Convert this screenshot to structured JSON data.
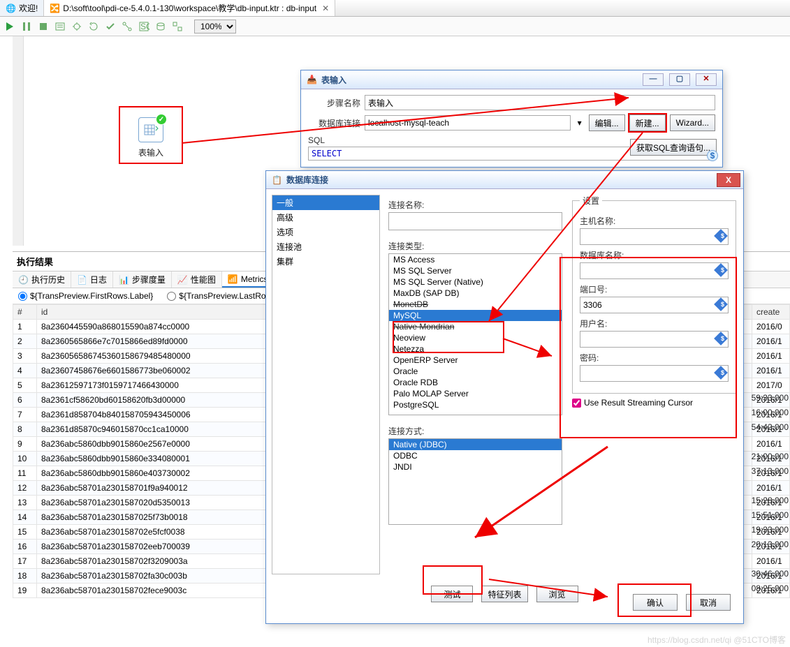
{
  "tabs": {
    "welcome": "欢迎!",
    "file": "D:\\soft\\tool\\pdi-ce-5.4.0.1-130\\workspace\\教学\\db-input.ktr : db-input"
  },
  "toolbar": {
    "zoom": "100%"
  },
  "node": {
    "label": "表输入"
  },
  "results": {
    "title": "执行结果",
    "tabs": [
      "执行历史",
      "日志",
      "步骤度量",
      "性能图",
      "Metrics"
    ],
    "radio1": "${TransPreview.FirstRows.Label}",
    "radio2": "${TransPreview.LastRo",
    "cols": [
      "#",
      "id",
      "create"
    ]
  },
  "rows": [
    {
      "n": "1",
      "id": "8a2360445590a868015590a874cc0000",
      "c": "2016/0"
    },
    {
      "n": "2",
      "id": "8a2360565866e7c7015866ed89fd0000",
      "c": "2016/1"
    },
    {
      "n": "3",
      "id": "8a236056586745360158679485480000",
      "c": "2016/1"
    },
    {
      "n": "4",
      "id": "8a23607458676e6601586773be060002",
      "c": "2016/1"
    },
    {
      "n": "5",
      "id": "8a23612597173f0159717466430000",
      "c": "2017/0"
    },
    {
      "n": "6",
      "id": "8a2361cf58620bd60158620fb3d00000",
      "c": "2016/1"
    },
    {
      "n": "7",
      "id": "8a2361d858704b840158705943450006",
      "c": "2016/1"
    },
    {
      "n": "8",
      "id": "8a2361d85870c946015870cc1ca10000",
      "c": "2016/1"
    },
    {
      "n": "9",
      "id": "8a236abc5860dbb9015860e2567e0000",
      "c": "2016/1"
    },
    {
      "n": "10",
      "id": "8a236abc5860dbb9015860e334080001",
      "c": "2016/1"
    },
    {
      "n": "11",
      "id": "8a236abc5860dbb9015860e403730002",
      "c": "2016/1"
    },
    {
      "n": "12",
      "id": "8a236abc58701a230158701f9a940012",
      "c": "2016/1"
    },
    {
      "n": "13",
      "id": "8a236abc58701a2301587020d5350013",
      "c": "2016/1"
    },
    {
      "n": "14",
      "id": "8a236abc58701a2301587025f73b0018",
      "c": "2016/1"
    },
    {
      "n": "15",
      "id": "8a236abc58701a230158702e5fcf0038",
      "c": "2016/1"
    },
    {
      "n": "16",
      "id": "8a236abc58701a230158702eeb700039",
      "c": "2016/1"
    },
    {
      "n": "17",
      "id": "8a236abc58701a230158702f3209003a",
      "c": "2016/1"
    },
    {
      "n": "18",
      "id": "8a236abc58701a230158702fa30c003b",
      "c": "2016/1"
    },
    {
      "n": "19",
      "id": "8a236abc58701a230158702fece9003c",
      "c": "2016/1"
    }
  ],
  "right_times": [
    "59:33.000",
    "16:00.000",
    "54:42.000",
    "",
    "21:00.000",
    "37:13.000",
    "",
    "15:28.000",
    "15:51.000",
    "19:33.000",
    "20:13.000",
    "",
    "30:46.000",
    "08:25.000"
  ],
  "dlg1": {
    "title": "表输入",
    "step_label": "步骤名称",
    "step_value": "表输入",
    "conn_label": "数据库连接",
    "conn_value": "localhost-mysql-teach",
    "btn_edit": "编辑...",
    "btn_new": "新建...",
    "btn_wizard": "Wizard...",
    "sql_label": "SQL",
    "btn_fetch": "获取SQL查询语句...",
    "sql_text": "SELECT"
  },
  "dlg2": {
    "title": "数据库连接",
    "nav": [
      "一般",
      "高级",
      "选项",
      "连接池",
      "集群"
    ],
    "conn_name_label": "连接名称:",
    "conn_name": "",
    "type_label": "连接类型:",
    "types": [
      "MS Access",
      "MS SQL Server",
      "MS SQL Server (Native)",
      "MaxDB (SAP DB)",
      "MonetDB",
      "MySQL",
      "Native Mondrian",
      "Neoview",
      "Netezza",
      "OpenERP Server",
      "Oracle",
      "Oracle RDB",
      "Palo MOLAP Server",
      "PostgreSQL"
    ],
    "type_selected": "MySQL",
    "access_label": "连接方式:",
    "access": [
      "Native (JDBC)",
      "ODBC",
      "JNDI"
    ],
    "access_selected": "Native (JDBC)",
    "settings_label": "设置",
    "host_label": "主机名称:",
    "db_label": "数据库名称:",
    "port_label": "端口号:",
    "port_value": "3306",
    "user_label": "用户名:",
    "pass_label": "密码:",
    "chk_label": "Use Result Streaming Cursor",
    "btn_test": "测试",
    "btn_feat": "特征列表",
    "btn_browse": "浏览",
    "btn_ok": "确认",
    "btn_cancel": "取消"
  },
  "watermark": "https://blog.csdn.net/qi @51CTO博客"
}
